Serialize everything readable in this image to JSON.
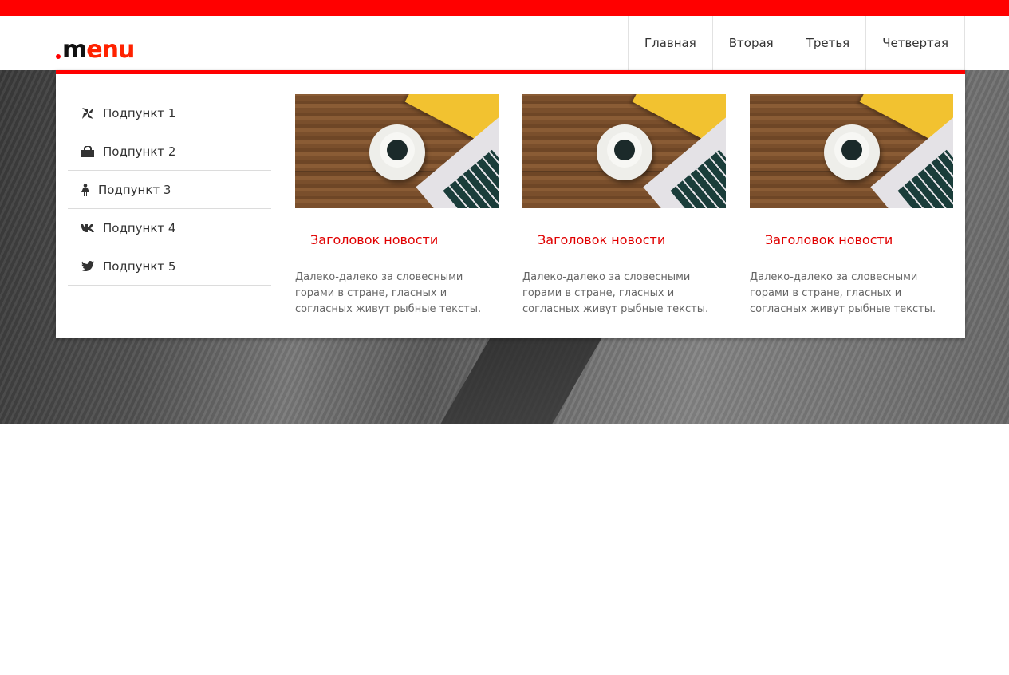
{
  "colors": {
    "accent": "#ff0000",
    "link": "#e00000",
    "text": "#333333",
    "muted": "#666666"
  },
  "logo": {
    "dot": ".",
    "m": "m",
    "rest": "enu"
  },
  "nav": {
    "items": [
      {
        "label": "Главная"
      },
      {
        "label": "Вторая"
      },
      {
        "label": "Третья"
      },
      {
        "label": "Четвертая"
      }
    ]
  },
  "sidebar": {
    "items": [
      {
        "label": "Подпункт 1",
        "icon": "pinwheel-icon"
      },
      {
        "label": "Подпункт 2",
        "icon": "shopping-bag-icon"
      },
      {
        "label": "Подпункт 3",
        "icon": "female-icon"
      },
      {
        "label": "Подпункт 4",
        "icon": "vk-icon"
      },
      {
        "label": "Подпункт 5",
        "icon": "twitter-icon"
      }
    ]
  },
  "news": [
    {
      "title": "Заголовок новости",
      "text": "Далеко-далеко за словесными горами в стране, гласных и согласных живут рыбные тексты."
    },
    {
      "title": "Заголовок новости",
      "text": "Далеко-далеко за словесными горами в стране, гласных и согласных живут рыбные тексты."
    },
    {
      "title": "Заголовок новости",
      "text": "Далеко-далеко за словесными горами в стране, гласных и согласных живут рыбные тексты."
    }
  ]
}
